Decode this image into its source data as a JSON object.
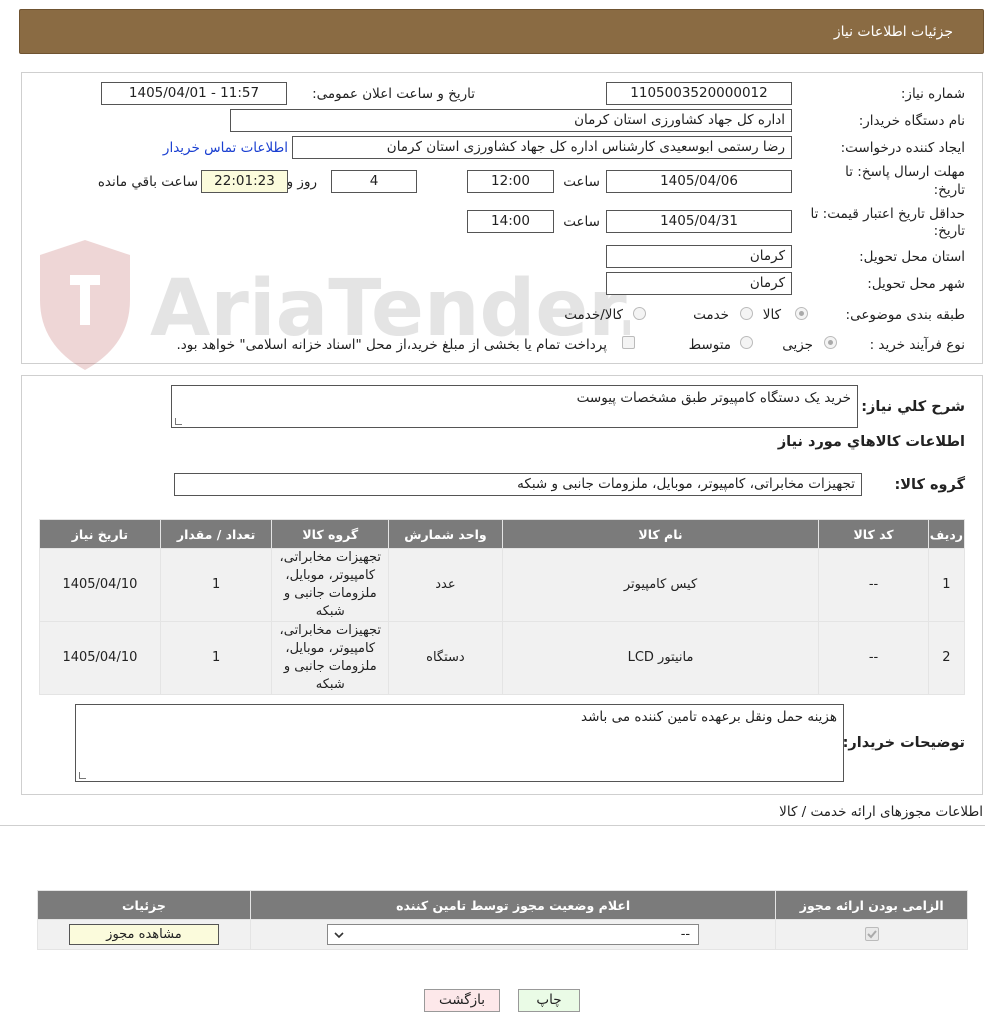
{
  "header": {
    "title": "جزئیات اطلاعات نیاز"
  },
  "form": {
    "need_number_label": "شماره نیاز:",
    "need_number": "1105003520000012",
    "announce_label": "تاریخ و ساعت اعلان عمومی:",
    "announce_value": "1405/04/01 - 11:57",
    "buyer_org_label": "نام دستگاه خریدار:",
    "buyer_org": "اداره کل جهاد کشاورزی استان کرمان",
    "requester_label": "ایجاد کننده درخواست:",
    "requester": "رضا رستمی ابوسعیدی کارشناس اداره کل جهاد کشاورزی استان کرمان",
    "contact_link": "اطلاعات تماس خریدار",
    "reply_deadline_label_1": "مهلت ارسال پاسخ: تا",
    "reply_deadline_label_2": "تاریخ:",
    "reply_date": "1405/04/06",
    "time_label": "ساعت",
    "reply_time": "12:00",
    "days_value": "4",
    "days_label": "روز و",
    "remaining_time": "22:01:23",
    "remaining_label": "ساعت باقي مانده",
    "price_validity_label_1": "حداقل تاریخ اعتبار قیمت: تا",
    "price_validity_label_2": "تاریخ:",
    "price_validity_date": "1405/04/31",
    "price_validity_time": "14:00",
    "province_label": "استان محل تحویل:",
    "province": "کرمان",
    "city_label": "شهر محل تحویل:",
    "city": "کرمان",
    "category_label": "طبقه بندی موضوعی:",
    "category_options": [
      "کالا",
      "خدمت",
      "کالا/خدمت"
    ],
    "category_selected": "کالا",
    "process_label": "نوع فرآیند خرید :",
    "process_options": [
      "جزیی",
      "متوسط"
    ],
    "process_selected": "جزیی",
    "payment_note": "پرداخت تمام یا بخشی از مبلغ خرید،از محل \"اسناد خزانه اسلامی\" خواهد بود."
  },
  "description": {
    "label": "شرح کلي نیاز:",
    "value": "خرید یک دستگاه کامپیوتر طبق مشخصات پیوست"
  },
  "goods_section": {
    "title": "اطلاعات کالاهاي مورد نیاز",
    "group_label": "گروه کالا:",
    "group_value": "تجهیزات مخابراتی، کامپیوتر، موبایل، ملزومات جانبی و شبکه",
    "columns": [
      "ردیف",
      "کد کالا",
      "نام کالا",
      "واحد شمارش",
      "گروه کالا",
      "تعداد / مقدار",
      "تاریخ نیاز"
    ],
    "rows": [
      {
        "row": "1",
        "code": "--",
        "name": "کیس کامپیوتر",
        "unit": "عدد",
        "group": "تجهیزات مخابراتی، کامپیوتر، موبایل، ملزومات جانبی و شبکه",
        "qty": "1",
        "date": "1405/04/10"
      },
      {
        "row": "2",
        "code": "--",
        "name": "مانیتور LCD",
        "unit": "دستگاه",
        "group": "تجهیزات مخابراتی، کامپیوتر، موبایل، ملزومات جانبی و شبکه",
        "qty": "1",
        "date": "1405/04/10"
      }
    ]
  },
  "buyer_notes": {
    "label": "توضیحات خریدار:",
    "value": "هزینه حمل ونقل برعهده تامین کننده می باشد"
  },
  "permits": {
    "title": "اطلاعات مجوزهای ارائه خدمت / کالا",
    "columns": [
      "الزامی بودن ارائه مجوز",
      "اعلام وضعیت مجوز توسط تامین کننده",
      "جزئیات"
    ],
    "select_value": "--",
    "view_button": "مشاهده مجوز"
  },
  "actions": {
    "print": "چاپ",
    "back": "بازگشت"
  },
  "watermark": {
    "text": "AriaTender.neT"
  },
  "colors": {
    "header": "#8a6b43",
    "link": "#1a3fd1",
    "table_header": "#7b7b7b"
  }
}
